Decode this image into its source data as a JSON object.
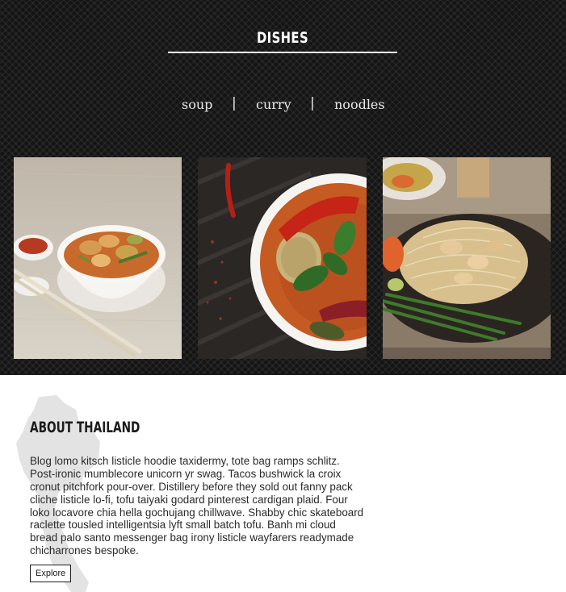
{
  "dishes": {
    "title": "DISHES",
    "nav": [
      {
        "label": "soup"
      },
      {
        "label": "curry"
      },
      {
        "label": "noodles"
      }
    ],
    "separator": "|"
  },
  "about": {
    "title": "ABOUT THAILAND",
    "body": "Blog lomo kitsch listicle hoodie taxidermy, tote bag ramps schlitz. Post-ironic mumblecore unicorn yr swag. Tacos bushwick la croix cronut pitchfork pour-over. Distillery before they sold out fanny pack cliche listicle lo-fi, tofu taiyaki godard pinterest cardigan plaid. Four loko locavore chia hella gochujang chillwave. Shabby chic skateboard raclette tousled intelligentsia lyft small batch tofu. Banh mi cloud bread palo santo messenger bag irony listicle wayfarers readymade chicharrones bespoke.",
    "button_label": "Explore"
  },
  "colors": {
    "dark_background": "#141414",
    "text_light": "#ffffff",
    "text_dark": "#1b1b1b",
    "map_silhouette": "#e3e3e3"
  }
}
